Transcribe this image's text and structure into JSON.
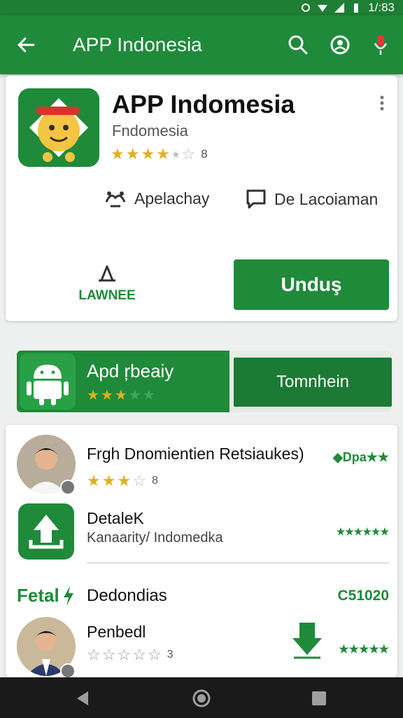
{
  "status_bar": {
    "time": "1/:83"
  },
  "app_bar": {
    "title": "APP Indonesia"
  },
  "app": {
    "name": "APP Indomesia",
    "developer": "Fndomesia",
    "rating_filled": 4,
    "rating_count": "8",
    "meta1_label": "Apelachay",
    "meta2_label": "De Lacoiaman",
    "secondary_label": "LAWNEE",
    "install_label": "Unduş"
  },
  "promo": {
    "title": "Apd ŗbeaiy",
    "rating_filled": 3,
    "open_label": "Tomnhein"
  },
  "list": {
    "items": [
      {
        "title": "Frgh Dnomientien Retsiaukes)",
        "rating_filled": 3,
        "rating_count": "8",
        "right": "◆Dpa★★"
      },
      {
        "title": "DetaleK",
        "subtitle": "Kanaarity/ Indomedka",
        "right": "★★★★★★"
      }
    ],
    "section_label": "Fetal",
    "section_title": "Dedondias",
    "section_value": "C51020",
    "last_item": {
      "title": "Penbedl",
      "rating_count": "3",
      "right": "★★★★★"
    }
  },
  "colors": {
    "primary": "#1f8a3a",
    "status_bar": "#1e7e34",
    "star": "#e0b020"
  }
}
